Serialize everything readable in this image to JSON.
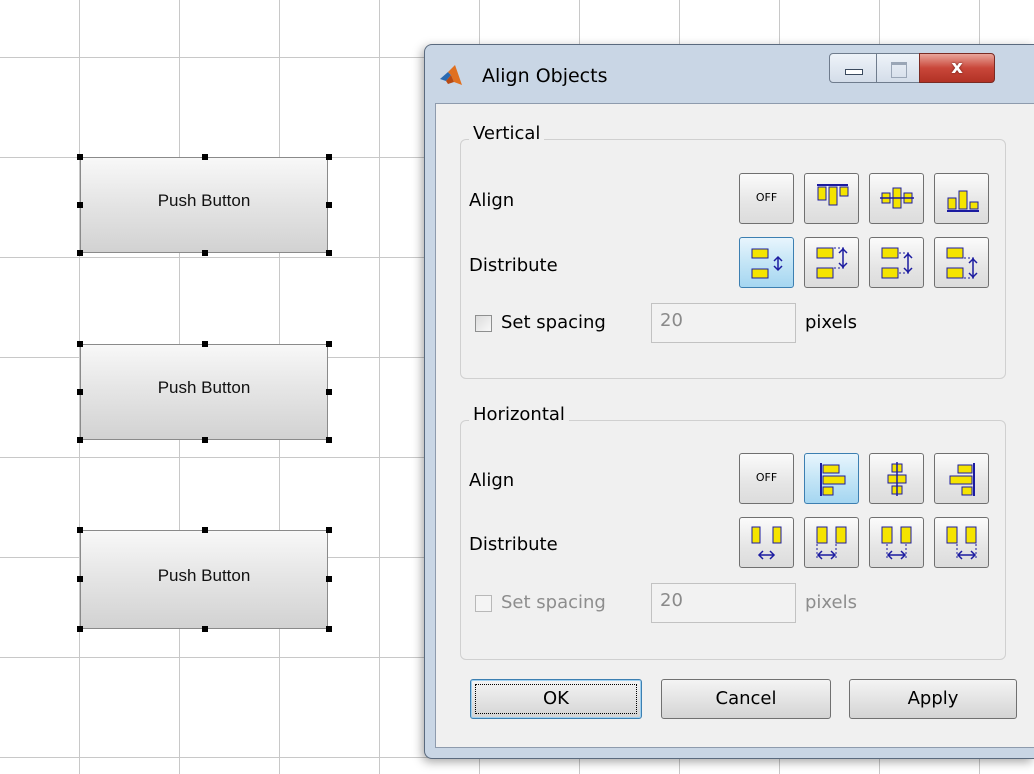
{
  "canvas": {
    "push_buttons": [
      {
        "label": "Push Button"
      },
      {
        "label": "Push Button"
      },
      {
        "label": "Push Button"
      }
    ]
  },
  "dialog": {
    "title": "Align Objects",
    "window_buttons": {
      "close": "x"
    },
    "vertical": {
      "title": "Vertical",
      "align_label": "Align",
      "distribute_label": "Distribute",
      "align_options": [
        {
          "label": "OFF",
          "icon": "align-off-icon",
          "selected": false
        },
        {
          "label": "",
          "icon": "align-top-icon",
          "selected": false
        },
        {
          "label": "",
          "icon": "align-middle-icon",
          "selected": false
        },
        {
          "label": "",
          "icon": "align-bottom-icon",
          "selected": false
        }
      ],
      "distribute_options": [
        {
          "icon": "distribute-gap-icon",
          "selected": true
        },
        {
          "icon": "distribute-top-icon",
          "selected": false
        },
        {
          "icon": "distribute-middle-icon",
          "selected": false
        },
        {
          "icon": "distribute-bottom-icon",
          "selected": false
        }
      ],
      "set_spacing_label": "Set spacing",
      "set_spacing_checked": false,
      "spacing_value": "20",
      "unit": "pixels"
    },
    "horizontal": {
      "title": "Horizontal",
      "align_label": "Align",
      "distribute_label": "Distribute",
      "align_options": [
        {
          "label": "OFF",
          "icon": "align-off-icon",
          "selected": false
        },
        {
          "label": "",
          "icon": "align-left-icon",
          "selected": true
        },
        {
          "label": "",
          "icon": "align-center-icon",
          "selected": false
        },
        {
          "label": "",
          "icon": "align-right-icon",
          "selected": false
        }
      ],
      "distribute_options": [
        {
          "icon": "distribute-gap-icon",
          "selected": false
        },
        {
          "icon": "distribute-left-icon",
          "selected": false
        },
        {
          "icon": "distribute-center-icon",
          "selected": false
        },
        {
          "icon": "distribute-right-icon",
          "selected": false
        }
      ],
      "set_spacing_label": "Set spacing",
      "set_spacing_checked": false,
      "set_spacing_enabled": false,
      "spacing_value": "20",
      "unit": "pixels"
    },
    "buttons": {
      "ok": "OK",
      "cancel": "Cancel",
      "apply": "Apply"
    },
    "colors": {
      "selected_fill": "#a5d6f1",
      "icon_yellow": "#f5e400",
      "icon_blue": "#1b1ba0",
      "close_red": "#c9473a"
    }
  }
}
